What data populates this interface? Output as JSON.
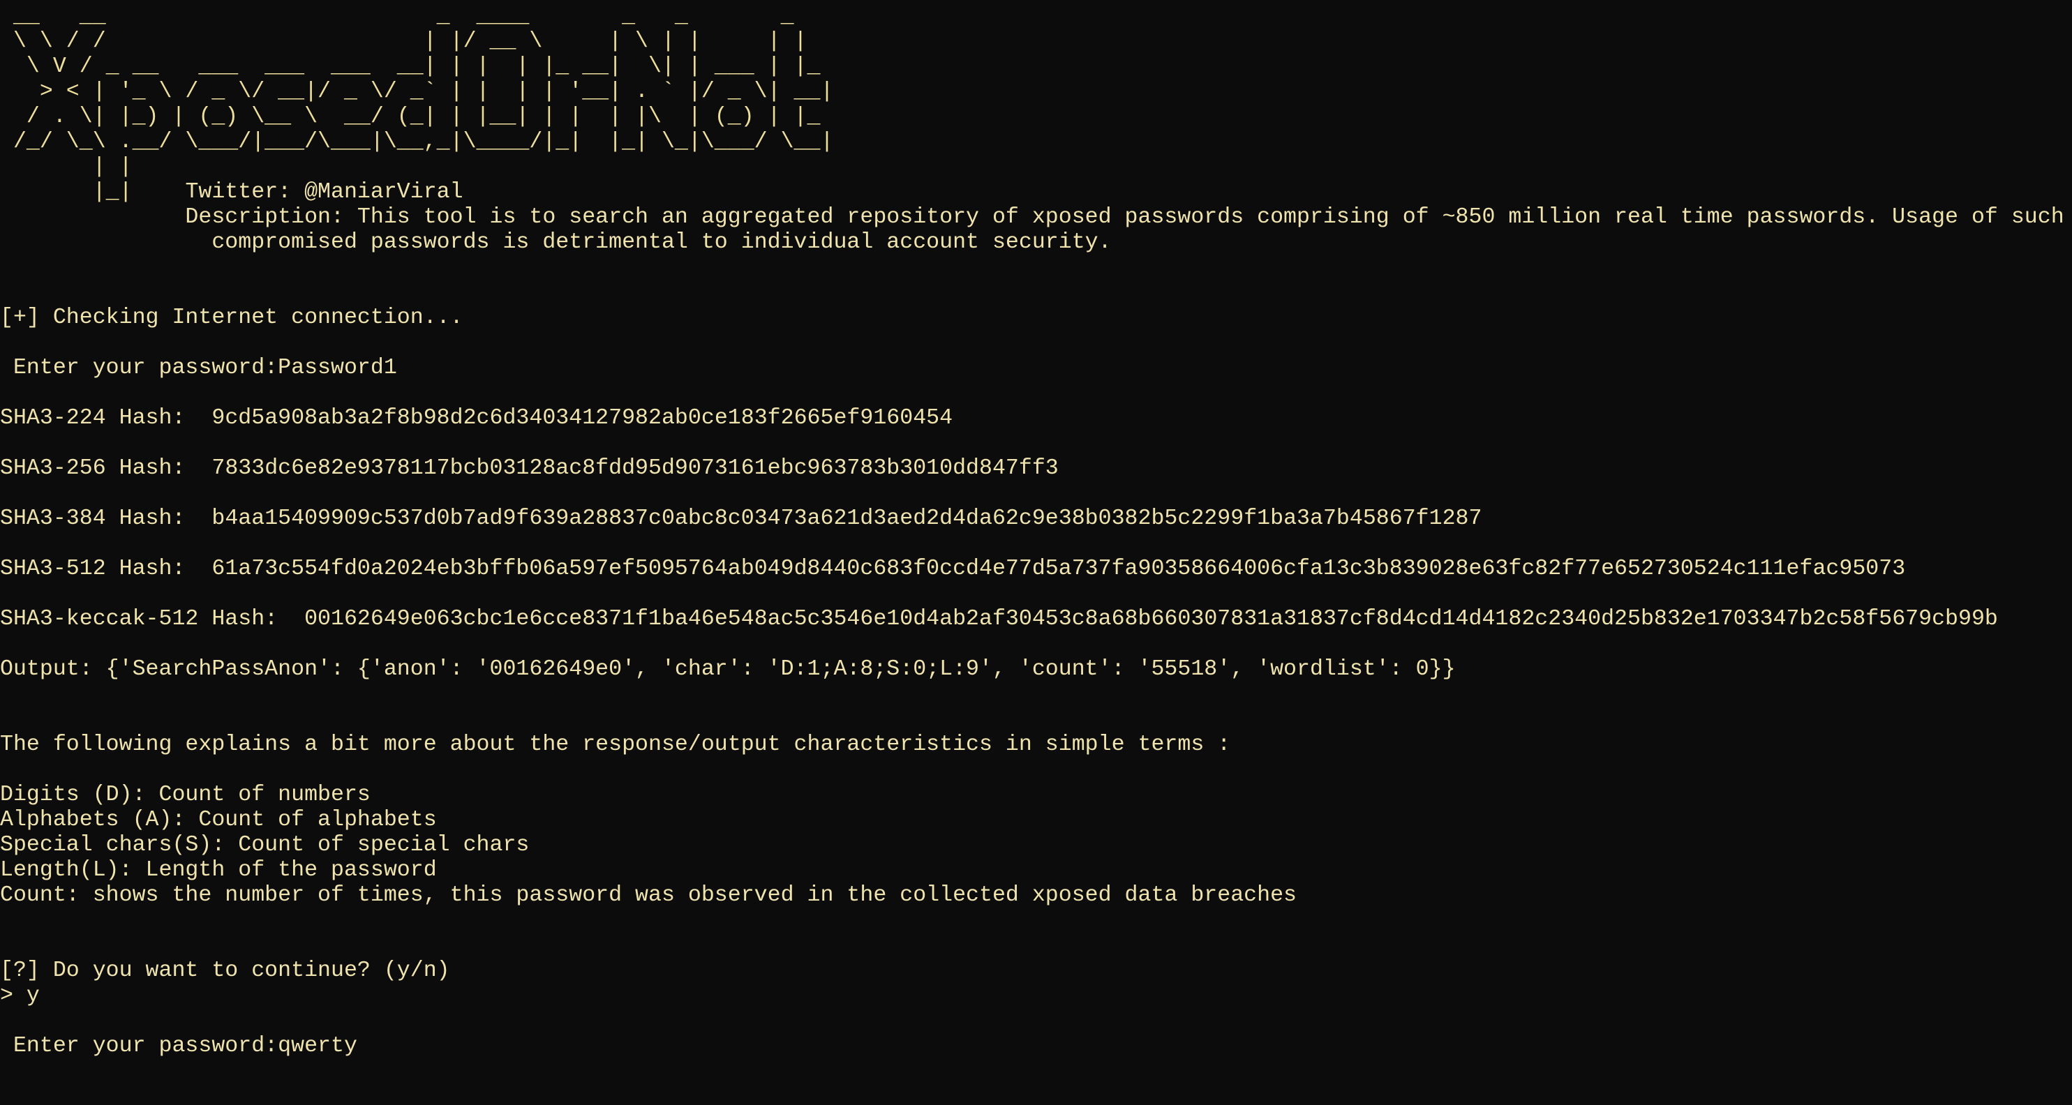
{
  "banner": {
    "art_lines": [
      " __   __                         _  ____       _   _       _",
      " \\ \\ / /                        | |/ __ \\     | \\ | |     | |",
      "  \\ V / _ __   ___  ___  ___  __| | |  | |_ __|  \\| | ___ | |_",
      "   > < | '_ \\ / _ \\/ __|/ _ \\/ _` | |  | | '__| . ` |/ _ \\| __|",
      "  / . \\| |_) | (_) \\__ \\  __/ (_| | |__| | |  | |\\  | (_) | |_",
      " /_/ \\_\\ .__/ \\___/|___/\\___|\\__,_|\\____/|_|  |_| \\_|\\___/ \\__|",
      "       | |",
      "       |_|    "
    ],
    "twitter": "Twitter: @ManiarViral",
    "description_line1": "              Description: This tool is to search an aggregated repository of xposed passwords comprising of ~850 million real time passwords. Usage of such",
    "description_line2": "                compromised passwords is detrimental to individual account security."
  },
  "session": {
    "checking": "[+] Checking Internet connection...",
    "prompt1": " Enter your password:Password1",
    "hashes": [
      {
        "label": "SHA3-224 Hash:  ",
        "value": "9cd5a908ab3a2f8b98d2c6d34034127982ab0ce183f2665ef9160454"
      },
      {
        "label": "SHA3-256 Hash:  ",
        "value": "7833dc6e82e9378117bcb03128ac8fdd95d9073161ebc963783b3010dd847ff3"
      },
      {
        "label": "SHA3-384 Hash:  ",
        "value": "b4aa15409909c537d0b7ad9f639a28837c0abc8c03473a621d3aed2d4da62c9e38b0382b5c2299f1ba3a7b45867f1287"
      },
      {
        "label": "SHA3-512 Hash:  ",
        "value": "61a73c554fd0a2024eb3bffb06a597ef5095764ab049d8440c683f0ccd4e77d5a737fa90358664006cfa13c3b839028e63fc82f77e652730524c111efac95073"
      },
      {
        "label": "SHA3-keccak-512 Hash:  ",
        "value": "00162649e063cbc1e6cce8371f1ba46e548ac5c3546e10d4ab2af30453c8a68b660307831a31837cf8d4cd14d4182c2340d25b832e1703347b2c58f5679cb99b"
      }
    ],
    "output": "Output: {'SearchPassAnon': {'anon': '00162649e0', 'char': 'D:1;A:8;S:0;L:9', 'count': '55518', 'wordlist': 0}}",
    "explain_intro": "The following explains a bit more about the response/output characteristics in simple terms :",
    "explain_lines": [
      "Digits (D): Count of numbers",
      "Alphabets (A): Count of alphabets",
      "Special chars(S): Count of special chars",
      "Length(L): Length of the password",
      "Count: shows the number of times, this password was observed in the collected xposed data breaches"
    ],
    "continue_prompt": "[?] Do you want to continue? (y/n)",
    "continue_answer": "> y",
    "prompt2": " Enter your password:qwerty"
  },
  "colors": {
    "background": "#0c0c0c",
    "text": "#f0e4ae"
  }
}
